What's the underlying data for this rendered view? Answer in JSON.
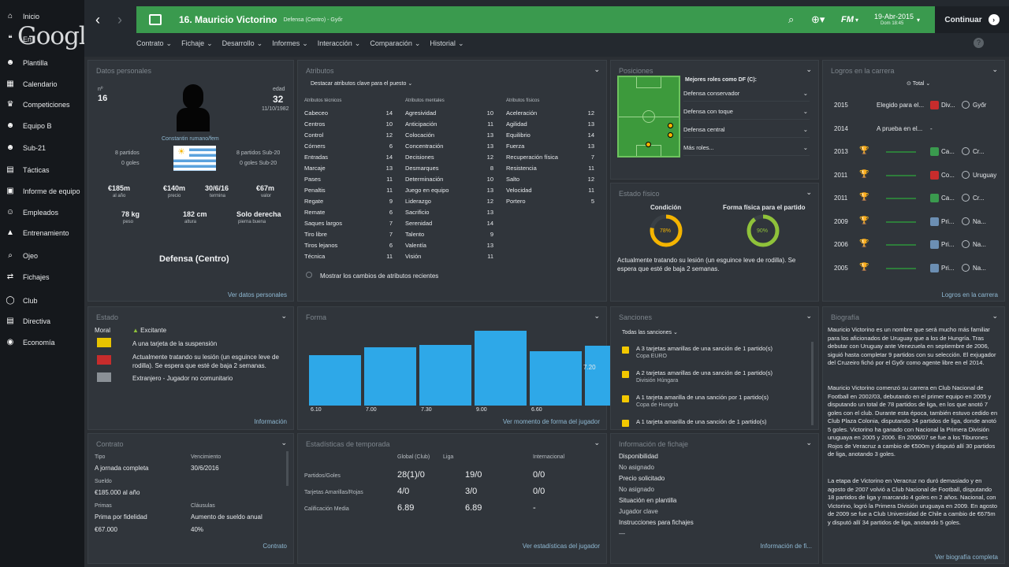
{
  "sidebar": {
    "items": [
      {
        "label": "Inicio",
        "icon": "home-icon"
      },
      {
        "label": "En",
        "icon": "hangouts-icon"
      },
      {
        "label": "Plantilla",
        "icon": "people-icon"
      },
      {
        "label": "Calendario",
        "icon": "calendar-icon"
      },
      {
        "label": "Competiciones",
        "icon": "trophy-icon"
      },
      {
        "label": "Equipo B",
        "icon": "people-icon"
      },
      {
        "label": "Sub-21",
        "icon": "people-icon"
      },
      {
        "label": "Tácticas",
        "icon": "board-icon"
      },
      {
        "label": "Informe de equipo",
        "icon": "report-icon"
      },
      {
        "label": "Empleados",
        "icon": "staff-icon"
      },
      {
        "label": "Entrenamiento",
        "icon": "training-icon"
      },
      {
        "label": "Ojeo",
        "icon": "search-icon"
      },
      {
        "label": "Fichajes",
        "icon": "transfer-icon"
      },
      {
        "label": "Club",
        "icon": "shield-icon"
      },
      {
        "label": "Directiva",
        "icon": "board-icon"
      },
      {
        "label": "Economía",
        "icon": "coin-icon"
      }
    ],
    "overlay_logo": "Google"
  },
  "header": {
    "player_title": "16. Mauricio Victorino",
    "player_sub": "Defensa (Centro) - Győr",
    "brand": "FM",
    "date": "19-Abr-2015",
    "time": "Dom 18:45",
    "continue": "Continuar",
    "accent": "#3a9a4e"
  },
  "subnav": [
    "Contrato",
    "Fichaje",
    "Desarrollo",
    "Informes",
    "Interacción",
    "Comparación",
    "Historial"
  ],
  "personal": {
    "title": "Datos personales",
    "num_label": "nº",
    "num": "16",
    "age_label": "edad",
    "age": "32",
    "birth": "11/10/1982",
    "nation_link": "Constantin rumano/fem",
    "caps_left": "8 partidos",
    "goals_left": "0 goles",
    "caps_right": "8 partidos Sub-20",
    "goals_right": "0 goles Sub-20",
    "values": [
      {
        "v": "€185m",
        "l": "al año"
      },
      {
        "v": "€140m",
        "l": "precio"
      },
      {
        "v": "30/6/16",
        "l": "termina"
      },
      {
        "v": "€67m",
        "l": "valor"
      }
    ],
    "body": [
      {
        "v": "78 kg",
        "l": "peso"
      },
      {
        "v": "182 cm",
        "l": "altura"
      },
      {
        "v": "Solo derecha",
        "l": "pierna buena"
      }
    ],
    "position": "Defensa (Centro)",
    "link": "Ver datos personales"
  },
  "attributes": {
    "title": "Atributos",
    "dropdown": "Destacar atributos clave para el puesto",
    "headers": [
      "Atributos técnicos",
      "Atributos mentales",
      "Atributos físicos"
    ],
    "technical": [
      [
        "Cabeceo",
        "14"
      ],
      [
        "Centros",
        "10"
      ],
      [
        "Control",
        "12"
      ],
      [
        "Córners",
        "6"
      ],
      [
        "Entradas",
        "14"
      ],
      [
        "Marcaje",
        "13"
      ],
      [
        "Pases",
        "11"
      ],
      [
        "Penaltis",
        "11"
      ],
      [
        "Regate",
        "9"
      ],
      [
        "Remate",
        "6"
      ],
      [
        "Saques largos",
        "7"
      ],
      [
        "Tiro libre",
        "7"
      ],
      [
        "Tiros lejanos",
        "6"
      ],
      [
        "Técnica",
        "11"
      ]
    ],
    "mental": [
      [
        "Agresividad",
        "10"
      ],
      [
        "Anticipación",
        "11"
      ],
      [
        "Colocación",
        "13"
      ],
      [
        "Concentración",
        "13"
      ],
      [
        "Decisiones",
        "12"
      ],
      [
        "Desmarques",
        "8"
      ],
      [
        "Determinación",
        "10"
      ],
      [
        "Juego en equipo",
        "13"
      ],
      [
        "Liderazgo",
        "12"
      ],
      [
        "Sacrificio",
        "13"
      ],
      [
        "Serenidad",
        "14"
      ],
      [
        "Talento",
        "9"
      ],
      [
        "Valentía",
        "13"
      ],
      [
        "Visión",
        "11"
      ]
    ],
    "physical": [
      [
        "Aceleración",
        "12"
      ],
      [
        "Agilidad",
        "13"
      ],
      [
        "Equilibrio",
        "14"
      ],
      [
        "Fuerza",
        "13"
      ],
      [
        "Recuperación física",
        "7"
      ],
      [
        "Resistencia",
        "11"
      ],
      [
        "Salto",
        "12"
      ],
      [
        "Velocidad",
        "11"
      ],
      [
        "Portero",
        "5"
      ]
    ],
    "toggle": "Mostrar los cambios de atributos recientes"
  },
  "positions": {
    "title": "Posiciones",
    "roles_title": "Mejores roles como DF (C):",
    "roles": [
      "Defensa conservador",
      "Defensa con toque",
      "Defensa central",
      "Más roles..."
    ]
  },
  "fitness": {
    "title": "Estado físico",
    "cond_label": "Condición",
    "cond": "78%",
    "cond_value": 78,
    "match_label": "Forma física para el partido",
    "match": "90%",
    "match_value": 90,
    "note": "Actualmente tratando su lesión (un esguince leve de rodilla). Se espera que esté de baja 2 semanas."
  },
  "history": {
    "title": "Logros en la carrera",
    "filter": "Total",
    "rows": [
      {
        "year": "2015",
        "text": "Elegido para el...",
        "comp": "Div...",
        "club": "Győr"
      },
      {
        "year": "2014",
        "text": "A prueba en el...",
        "comp": "-",
        "club": ""
      },
      {
        "year": "2013",
        "text": "",
        "comp": "Ca...",
        "club": "Cr..."
      },
      {
        "year": "2011",
        "text": "",
        "comp": "Co...",
        "club": "Uruguay"
      },
      {
        "year": "2011",
        "text": "",
        "comp": "Ca...",
        "club": "Cr..."
      },
      {
        "year": "2009",
        "text": "",
        "comp": "Pri...",
        "club": "Na..."
      },
      {
        "year": "2006",
        "text": "",
        "comp": "Pri...",
        "club": "Na..."
      },
      {
        "year": "2005",
        "text": "",
        "comp": "Pri...",
        "club": "Na..."
      }
    ],
    "link": "Logros en la carrera"
  },
  "status": {
    "title": "Estado",
    "rows": [
      {
        "label": "Moral",
        "value": "Excitante"
      },
      {
        "label": "",
        "value": "A una tarjeta de la suspensión"
      },
      {
        "label": "",
        "value": "Actualmente tratando su lesión (un esguince leve de rodilla). Se espera que esté de baja 2 semanas."
      },
      {
        "label": "",
        "value": "Extranjero - Jugador no comunitario"
      }
    ],
    "link": "Información"
  },
  "form": {
    "title": "Forma",
    "values": [
      6.1,
      7.0,
      7.3,
      9.0,
      6.6,
      7.2
    ],
    "labels": [
      "6.10",
      "7.00",
      "7.30",
      "9.00",
      "6.60"
    ],
    "last": "7.20",
    "link": "Ver momento de forma del jugador"
  },
  "sanctions": {
    "title": "Sanciones",
    "filter": "Todas las sanciones",
    "items": [
      {
        "text": "A 3 tarjetas amarillas de una sanción de 1 partido(s)",
        "comp": "Copa EURO"
      },
      {
        "text": "A 2 tarjetas amarillas de una sanción de 1 partido(s)",
        "comp": "División Húngara"
      },
      {
        "text": "A 1 tarjeta amarilla de una sanción por 1 partido(s)",
        "comp": "Copa de Hungría"
      },
      {
        "text": "A 1 tarjeta amarilla de una sanción de 1 partido(s)",
        "comp": ""
      }
    ]
  },
  "bio": {
    "title": "Biografía",
    "p1": "Mauricio Victorino es un nombre que será mucho más familiar para los aficionados de Uruguay que a los de Hungría. Tras debutar con Uruguay ante Venezuela en septiembre de 2006, siguió hasta completar 9 partidos con su selección. El exjugador del Cruzeiro fichó por el Győr como agente libre en el 2014.",
    "p2": "Mauricio Victorino comenzó su carrera en Club Nacional de Football en 2002/03, debutando en el primer equipo en 2005 y disputando un total de 78 partidos de liga, en los que anotó 7 goles con el club. Durante esta época, también estuvo cedido en Club Plaza Colonia, disputando 34 partidos de liga, donde anotó 5 goles. Victorino ha ganado con Nacional la Primera División uruguaya en 2005 y 2006. En 2006/07 se fue a los Tiburones Rojos de Veracruz a cambio de €500m y disputó allí 30 partidos de liga, anotando 3 goles.",
    "p3": "La etapa de Victorino en Veracruz no duró demasiado y en agosto de 2007 volvió a Club Nacional de Football, disputando 18 partidos de liga y marcando 4 goles en 2 años. Nacional, con Victorino, logró la Primera División uruguaya en 2009. En agosto de 2009 se fue a Club Universidad de Chile a cambio de €675m y disputó allí 34 partidos de liga, anotando 5 goles.",
    "link": "Ver biografía completa"
  },
  "contract": {
    "title": "Contrato",
    "type_l": "Tipo",
    "type_v": "A jornada completa",
    "exp_l": "Vencimiento",
    "exp_v": "30/6/2016",
    "wage_l": "Sueldo",
    "wage_v": "€185.000 al año",
    "prim_l": "Primas",
    "prim_v": "Prima por fidelidad",
    "prim_amt": "€67.000",
    "cl_l": "Cláusulas",
    "cl_v": "Aumento de sueldo anual",
    "cl_amt": "40%",
    "link": "Contrato"
  },
  "season": {
    "title": "Estadísticas de temporada",
    "cols": [
      "Global (Club)",
      "Liga",
      "Internacional"
    ],
    "rows": [
      {
        "label": "Partidos/Goles",
        "v": [
          "28(1)/0",
          "19/0",
          "0/0"
        ]
      },
      {
        "label": "Tarjetas Amarillas/Rojas",
        "v": [
          "4/0",
          "3/0",
          "0/0"
        ]
      },
      {
        "label": "Calificación Media",
        "v": [
          "6.89",
          "6.89",
          "-"
        ]
      }
    ],
    "link": "Ver estadísticas del jugador"
  },
  "transfer": {
    "title": "Información de fichaje",
    "rows": [
      {
        "l": "Disponibilidad",
        "v": "No asignado"
      },
      {
        "l": "Precio solicitado",
        "v": "No asignado"
      },
      {
        "l": "Situación en plantilla",
        "v": "Jugador clave"
      },
      {
        "l": "Instrucciones para fichajes",
        "v": "—"
      }
    ],
    "link": "Información de fi..."
  }
}
